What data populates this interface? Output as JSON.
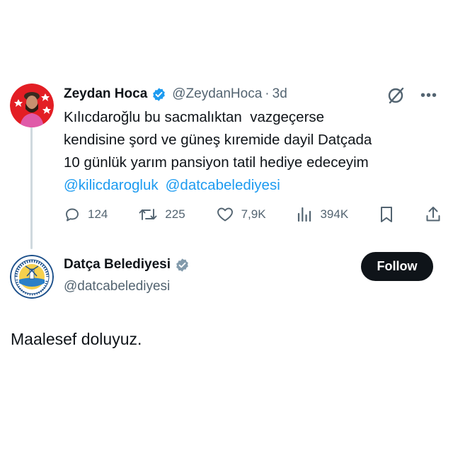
{
  "tweet": {
    "author": {
      "name": "Zeydan Hoca",
      "handle": "@ZeydanHoca",
      "time": "3d",
      "avatar_icon": "person-avatar-icon",
      "badge_color": "#1d9bf0"
    },
    "body_lines": [
      "Kılıcdaroğlu bu sacmalıktan  vazgeçerse",
      "kendisine şord ve güneş kıremide dayil Datçada",
      "10 günlük yarım pansiyon tatil hediye edeceyim"
    ],
    "mentions": [
      "@kilicdarogluk",
      "@datcabelediyesi"
    ],
    "actions": {
      "replies": "124",
      "reposts": "225",
      "likes": "7,9K",
      "views": "394K"
    }
  },
  "reply": {
    "author": {
      "name": "Datça Belediyesi",
      "handle": "@datcabelediyesi",
      "avatar_icon": "municipality-seal-icon",
      "badge_color": "#829aab"
    },
    "follow_label": "Follow",
    "body": "Maalesef doluyuz."
  },
  "colors": {
    "text": "#0f1419",
    "muted": "#536471",
    "link": "#1d9bf0",
    "thread_line": "#cfd9de",
    "button": "#0f1419"
  }
}
